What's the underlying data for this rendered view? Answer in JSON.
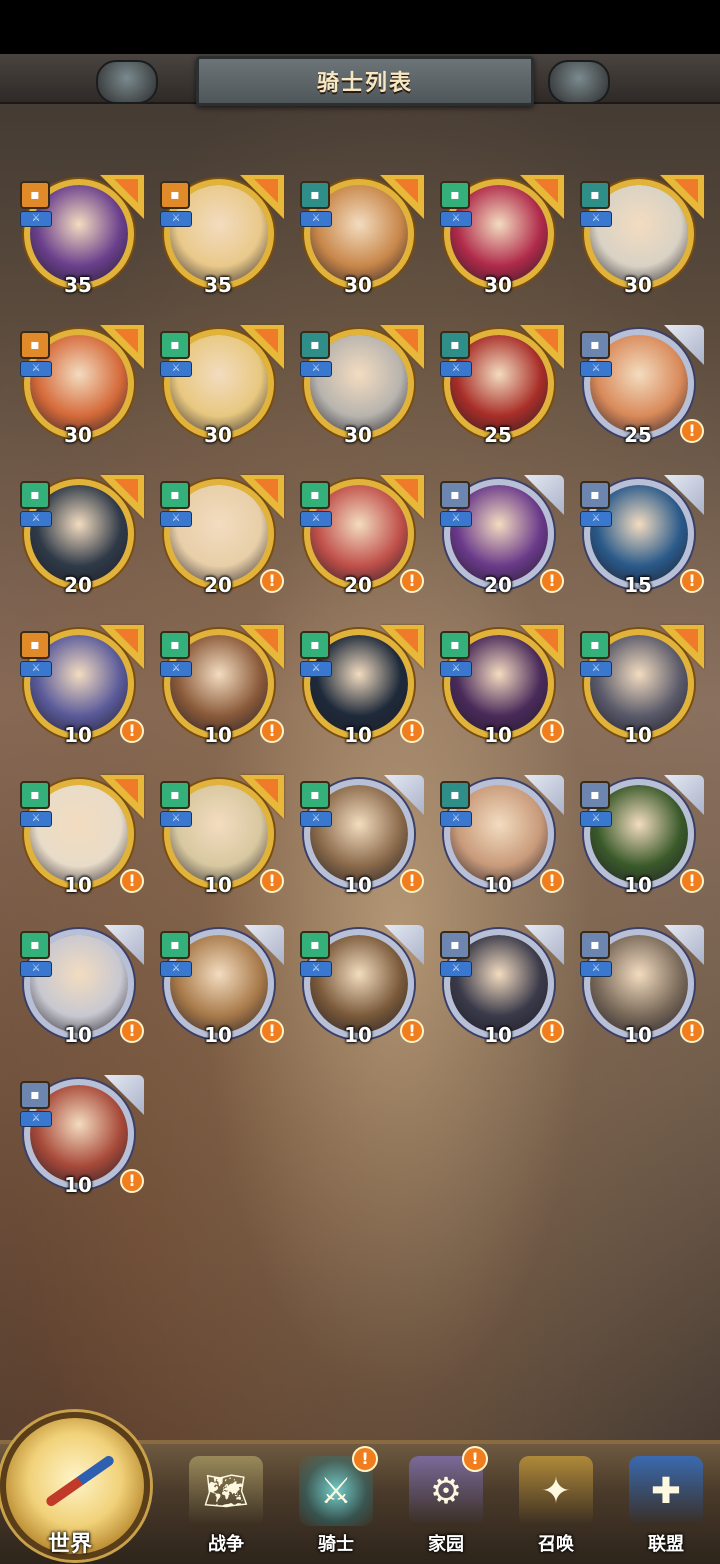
{
  "header": {
    "title": "骑士列表"
  },
  "colors": {
    "frame_gold": "#e2b33a",
    "frame_silver": "#b8c0d8",
    "alert_orange": "#f07d1e",
    "element_blue": "#3a78d0"
  },
  "knights": [
    {
      "level": "35",
      "frame": "gold",
      "job_color": "orange",
      "alert": false,
      "face": "#6a3f8c"
    },
    {
      "level": "35",
      "frame": "gold",
      "job_color": "orange",
      "alert": false,
      "face": "#e9c98a"
    },
    {
      "level": "30",
      "frame": "gold",
      "job_color": "teal",
      "alert": false,
      "face": "#c8874a"
    },
    {
      "level": "30",
      "frame": "gold",
      "job_color": "green",
      "alert": false,
      "face": "#b02a4a"
    },
    {
      "level": "30",
      "frame": "gold",
      "job_color": "teal",
      "alert": false,
      "face": "#d9d2c4"
    },
    {
      "level": "30",
      "frame": "gold",
      "job_color": "orange",
      "alert": false,
      "face": "#d56a3a"
    },
    {
      "level": "30",
      "frame": "gold",
      "job_color": "green",
      "alert": false,
      "face": "#e8c880"
    },
    {
      "level": "30",
      "frame": "gold",
      "job_color": "teal",
      "alert": false,
      "face": "#b8b4ae"
    },
    {
      "level": "25",
      "frame": "gold",
      "job_color": "teal",
      "alert": false,
      "face": "#a82e28"
    },
    {
      "level": "25",
      "frame": "silver",
      "job_color": "slate",
      "alert": true,
      "face": "#d98a5a"
    },
    {
      "level": "20",
      "frame": "gold",
      "job_color": "green",
      "alert": false,
      "face": "#2f3a48"
    },
    {
      "level": "20",
      "frame": "gold",
      "job_color": "green",
      "alert": true,
      "face": "#e8cfa8"
    },
    {
      "level": "20",
      "frame": "gold",
      "job_color": "green",
      "alert": true,
      "face": "#c0504a"
    },
    {
      "level": "20",
      "frame": "silver",
      "job_color": "slate",
      "alert": true,
      "face": "#6a3a8a"
    },
    {
      "level": "15",
      "frame": "silver",
      "job_color": "slate",
      "alert": true,
      "face": "#2a5a8a"
    },
    {
      "level": "10",
      "frame": "gold",
      "job_color": "orange",
      "alert": true,
      "face": "#5a5a9a"
    },
    {
      "level": "10",
      "frame": "gold",
      "job_color": "green",
      "alert": true,
      "face": "#8a5a3a"
    },
    {
      "level": "10",
      "frame": "gold",
      "job_color": "green",
      "alert": true,
      "face": "#1e2a3a"
    },
    {
      "level": "10",
      "frame": "gold",
      "job_color": "green",
      "alert": true,
      "face": "#4a2a5a"
    },
    {
      "level": "10",
      "frame": "gold",
      "job_color": "green",
      "alert": false,
      "face": "#5a5a6a"
    },
    {
      "level": "10",
      "frame": "gold",
      "job_color": "green",
      "alert": true,
      "face": "#e8dcc8"
    },
    {
      "level": "10",
      "frame": "gold",
      "job_color": "green",
      "alert": true,
      "face": "#d8c8a0"
    },
    {
      "level": "10",
      "frame": "silver",
      "job_color": "green",
      "alert": true,
      "face": "#8a6a4a"
    },
    {
      "level": "10",
      "frame": "silver",
      "job_color": "teal",
      "alert": true,
      "face": "#c89a7a"
    },
    {
      "level": "10",
      "frame": "silver",
      "job_color": "slate",
      "alert": true,
      "face": "#3a5a2a"
    },
    {
      "level": "10",
      "frame": "silver",
      "job_color": "green",
      "alert": true,
      "face": "#c8c8d0"
    },
    {
      "level": "10",
      "frame": "silver",
      "job_color": "green",
      "alert": true,
      "face": "#a87a4a"
    },
    {
      "level": "10",
      "frame": "silver",
      "job_color": "green",
      "alert": true,
      "face": "#7a5a3a"
    },
    {
      "level": "10",
      "frame": "silver",
      "job_color": "slate",
      "alert": true,
      "face": "#3a3a4a"
    },
    {
      "level": "10",
      "frame": "silver",
      "job_color": "slate",
      "alert": true,
      "face": "#7a6a5a"
    },
    {
      "level": "10",
      "frame": "silver",
      "job_color": "slate",
      "alert": true,
      "face": "#a84a3a"
    }
  ],
  "nav": {
    "world": "世界",
    "items": [
      {
        "label": "战争",
        "icon": "map-icon",
        "alert": false
      },
      {
        "label": "骑士",
        "icon": "knight-icon",
        "alert": true,
        "active": true
      },
      {
        "label": "家园",
        "icon": "gear-home-icon",
        "alert": true
      },
      {
        "label": "召唤",
        "icon": "summon-icon",
        "alert": false
      },
      {
        "label": "联盟",
        "icon": "alliance-icon",
        "alert": false
      }
    ]
  },
  "alert_mark": "!"
}
